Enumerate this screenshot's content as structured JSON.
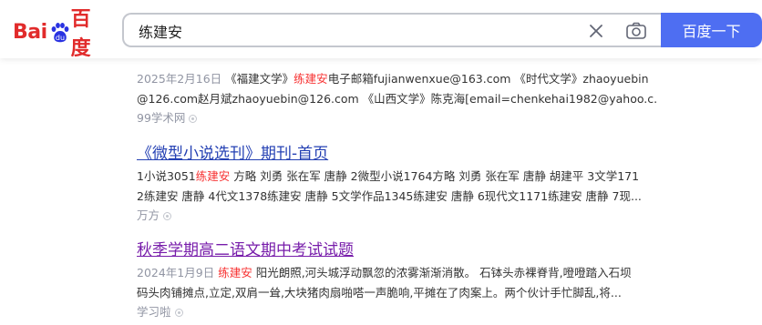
{
  "header": {
    "logo": {
      "bai": "Bai",
      "du": "du",
      "cn": "百度"
    },
    "search": {
      "value": "练建安",
      "placeholder": ""
    },
    "search_button": "百度一下"
  },
  "results": [
    {
      "title": "",
      "date": "2025年2月16日",
      "segments": [
        {
          "text": "《福建文学》",
          "hl": false
        },
        {
          "text": "练建安",
          "hl": true
        },
        {
          "text": "电子邮箱fujianwenxue@163.com 《时代文学》zhaoyuebin",
          "hl": false
        }
      ],
      "line2": "@126.com赵月斌zhaoyuebin@126.com 《山西文学》陈克海[email=chenkehai1982@yahoo.c...",
      "source": "99学术网",
      "visited": false
    },
    {
      "title": "《微型小说选刊》期刊-首页",
      "segments": [
        {
          "text": "1小说3051",
          "hl": false
        },
        {
          "text": "练建安",
          "hl": true
        },
        {
          "text": " 方略 刘勇 张在军 唐静 2微型小说1764方略 刘勇 张在军 唐静 胡建平 3文学171",
          "hl": false
        }
      ],
      "line2": "2练建安 唐静 4代文1378练建安 唐静 5文学作品1345练建安 唐静 6现代文1171练建安 唐静 7现...",
      "source": "万方",
      "visited": false
    },
    {
      "title": "秋季学期高二语文期中考试试题",
      "date": "2024年1月9日",
      "segments": [
        {
          "text": "练建安",
          "hl": true
        },
        {
          "text": " 阳光朗照,河头城浮动飘忽的浓雾渐渐消散。 石钵头赤裸脊背,噔噔踏入石坝",
          "hl": false
        }
      ],
      "line2": "码头肉铺摊点,立定,双肩一耸,大块猪肉扇啪嗒一声脆响,平摊在了肉案上。两个伙计手忙脚乱,将...",
      "source": "学习啦",
      "visited": true
    }
  ],
  "colors": {
    "brand_blue": "#4e6ef2",
    "link": "#2440b3",
    "visited": "#771caa",
    "highlight": "#f73131",
    "muted": "#9195a3"
  },
  "icons": {
    "clear": "close-icon",
    "camera": "camera-icon",
    "logo_paw": "baidu-paw-icon"
  }
}
